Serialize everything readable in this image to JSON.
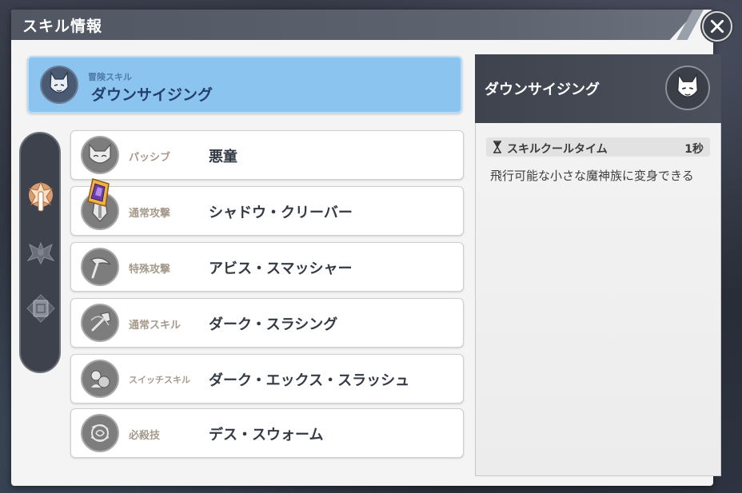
{
  "window": {
    "title": "スキル情報"
  },
  "selected": {
    "category": "冒険スキル",
    "name": "ダウンサイジング"
  },
  "skills": [
    {
      "category": "パッシブ",
      "name": "悪童",
      "icon": "demon-mask-icon"
    },
    {
      "category": "通常攻撃",
      "name": "シャドウ・クリーバー",
      "icon": "cleaver-icon"
    },
    {
      "category": "特殊攻撃",
      "name": "アビス・スマッシャー",
      "icon": "scythe-icon"
    },
    {
      "category": "通常スキル",
      "name": "ダーク・スラシング",
      "icon": "axe-icon"
    },
    {
      "category": "スイッチスキル",
      "name": "ダーク・エックス・スラッシュ",
      "icon": "switch-icon"
    },
    {
      "category": "必殺技",
      "name": "デス・スウォーム",
      "icon": "swarm-icon"
    }
  ],
  "side_tabs": [
    {
      "icon": "skill-emblem-icon",
      "active": true
    },
    {
      "icon": "bat-wing-icon",
      "active": false
    },
    {
      "icon": "book-icon",
      "active": false
    }
  ],
  "detail": {
    "name": "ダウンサイジング",
    "cooldown_label": "スキルクールタイム",
    "cooldown_value": "1秒",
    "description": "飛行可能な小さな魔神族に変身できる"
  },
  "colors": {
    "selected_bg": "#8cc4f0",
    "panel_dark": "#3e434d",
    "category_text": "#a59a8c",
    "gem": "#f2b440"
  }
}
